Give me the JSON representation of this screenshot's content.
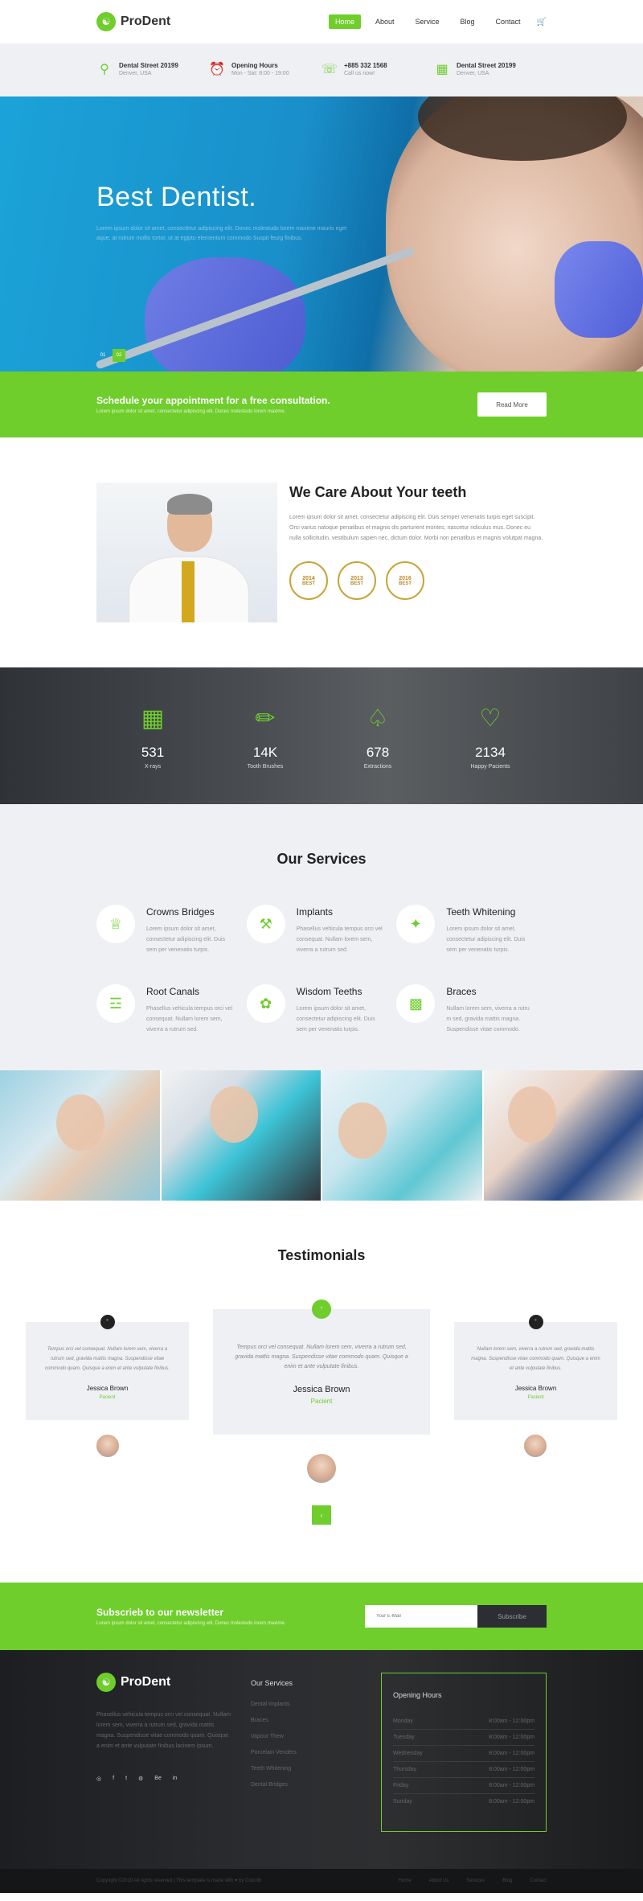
{
  "brand": {
    "name": "ProDent"
  },
  "nav": {
    "items": [
      "Home",
      "About",
      "Service",
      "Blog",
      "Contact"
    ],
    "cart_icon": "cart-icon"
  },
  "infobar": [
    {
      "icon": "location-icon",
      "title": "Dental Street 20199",
      "sub": "Denver, USA"
    },
    {
      "icon": "clock-icon",
      "title": "Opening Hours",
      "sub": "Mon - Sat: 8:00 - 19:00"
    },
    {
      "icon": "phone-icon",
      "title": "+885 332 1568",
      "sub": "Call us now!"
    },
    {
      "icon": "calendar-icon",
      "title": "Dental Street 20199",
      "sub": "Denver, USA"
    }
  ],
  "hero": {
    "title": "Best Dentist.",
    "text": "Lorem ipsum dolor sit amet, consectetur adipiscing elit. Donec molestudo lorem maxime mauris eget aque, at rutrum mollis tortor, ut at egiptu elementum commodo Suspit feurg finibus.",
    "dots": [
      "01",
      "02"
    ]
  },
  "cta": {
    "title": "Schedule your appointment for a free consultation.",
    "sub": "Lorem ipsum dolor sit amet, consectetur adipiscing elit. Donec molestudo lorem maxime.",
    "button": "Read More"
  },
  "about": {
    "title": "We Care About Your teeth",
    "text": "Lorem ipsum dolor sit amet, consectetur adipiscing elit. Duis semper venenatis turpis eget suscipit. Orci varius natoque penatibus et magnis dis parturient montes, nascetur ridiculus mus. Donec eu nulla sollicitudin, vestibulum sapien nec, dictum dolor. Morbi non penatibus et magnis volutpat magna.",
    "awards": [
      {
        "year": "2014",
        "label": "BEST"
      },
      {
        "year": "2013",
        "label": "BEST"
      },
      {
        "year": "2016",
        "label": "BEST"
      }
    ]
  },
  "stats": [
    {
      "icon": "xray-tooth-icon",
      "value": "531",
      "label": "X-rays"
    },
    {
      "icon": "toothbrush-icon",
      "value": "14K",
      "label": "Tooth Brushes"
    },
    {
      "icon": "extraction-icon",
      "value": "678",
      "label": "Extractions"
    },
    {
      "icon": "happy-tooth-icon",
      "value": "2134",
      "label": "Happy Pacients"
    }
  ],
  "services": {
    "title": "Our Services",
    "items": [
      {
        "icon": "crown-tooth-icon",
        "title": "Crowns Bridges",
        "text": "Lorem ipsum dolor sit amet, consectetur adipiscing elit. Duis sem per venenatis turpis."
      },
      {
        "icon": "implant-icon",
        "title": "Implants",
        "text": "Phasellus vehicula tempus orci vel consequat. Nullam lorem sem, viverra a rutrum sed."
      },
      {
        "icon": "whitening-icon",
        "title": "Teeth Whitening",
        "text": "Lorem ipsum dolor sit amet, consectetur adipiscing elit. Duis sem per venenatis turpis."
      },
      {
        "icon": "root-canal-icon",
        "title": "Root Canals",
        "text": "Phasellus vehicula tempus orci vel consequat. Nullam lorem sem, viverra a rutrum sed."
      },
      {
        "icon": "wisdom-tooth-icon",
        "title": "Wisdom Teeths",
        "text": "Lorem ipsum dolor sit amet, consectetur adipiscing elit. Duis sem per venenatis turpis."
      },
      {
        "icon": "braces-icon",
        "title": "Braces",
        "text": "Nullam lorem sem, viverra a rutru m sed, gravida mattis magna. Suspendisse vitae commodo."
      }
    ]
  },
  "testimonials": {
    "title": "Testimonials",
    "items": [
      {
        "text": "Tempus orci vel consequat. Nullam lorem sem, viverra a rutrum sed, gravida mattis magna. Suspendisse vitae commodo quam. Quisque a enim et ante vulputate finibus.",
        "name": "Jessica Brown",
        "role": "Pacient",
        "quote": "“"
      },
      {
        "text": "Tempus orci vel consequat. Nullam lorem sem, viverra a rutrum sed, gravida mattis magna. Suspendisse vitae commodo quam. Quisque a enim et ante vulputate finibus.",
        "name": "Jessica Brown",
        "role": "Pacient",
        "quote": "“"
      },
      {
        "text": "Nullam lorem sem, viverra a rutrum sed, gravida mattis magna. Suspendisse vitae commodo quam. Quisque a enim et ante vulputate finibus.",
        "name": "Jessica Brown",
        "role": "Pacient",
        "quote": "“"
      }
    ],
    "pager": "‹"
  },
  "newsletter": {
    "title": "Subscrieb to our newsletter",
    "sub": "Lorem ipsum dolor sit amet, consectetur adipiscing elit. Donec molestudo lorem maxime.",
    "placeholder": "Your E-Mail",
    "button": "Subscribe"
  },
  "footer": {
    "text": "Phasellus vehicula tempus orci vel consequat. Nullam lorem sem, viverra a rutrum sed, gravida mattis magna. Suspendisse vitae commodo quam. Quisque a enim et ante vulputate finibus lacinem ipsum.",
    "social": [
      "◎",
      "f",
      "t",
      "⚙",
      "Be",
      "in"
    ],
    "services_title": "Our Services",
    "services": [
      "Dental Implants",
      "Braces",
      "Vapour Thew",
      "Porcelain Venders",
      "Teeth Whitening",
      "Dental Bridges"
    ],
    "hours_title": "Opening Hours",
    "hours": [
      {
        "day": "Monday",
        "time": "8:00am - 12:00pm"
      },
      {
        "day": "Tuesday",
        "time": "8:00am - 12:00pm"
      },
      {
        "day": "Wednesday",
        "time": "8:00am - 12:00pm"
      },
      {
        "day": "Thursday",
        "time": "8:00am - 12:00pm"
      },
      {
        "day": "Friday",
        "time": "8:00am - 12:00pm"
      },
      {
        "day": "Sunday",
        "time": "8:00am - 12:00pm"
      }
    ],
    "copyright": "Copyright ©2019 All rights reserved | This template is made with ♥ by Colorlib",
    "bottom_links": [
      "Home",
      "About Us",
      "Services",
      "Blog",
      "Contact"
    ]
  },
  "colors": {
    "accent": "#6fce2c",
    "dark": "#2b2e32",
    "light_bg": "#eef0f4"
  }
}
